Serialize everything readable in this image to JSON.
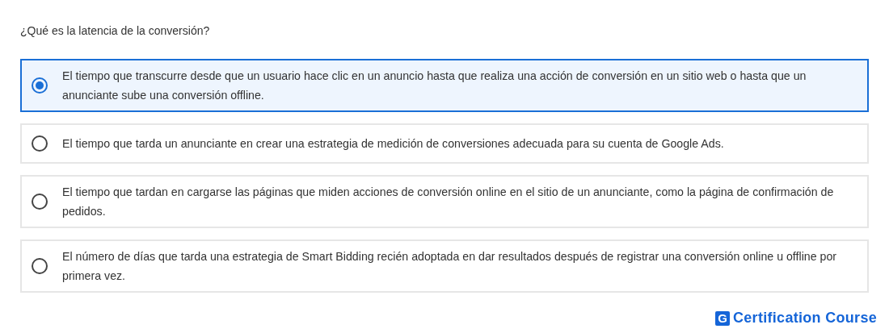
{
  "question": "¿Qué es la latencia de la conversión?",
  "options": [
    {
      "text": "El tiempo que transcurre desde que un usuario hace clic en un anuncio hasta que realiza una acción de conversión en un sitio web o hasta que un anunciante sube una conversión offline.",
      "selected": true
    },
    {
      "text": "El tiempo que tarda un anunciante en crear una estrategia de medición de conversiones adecuada para su cuenta de Google Ads.",
      "selected": false
    },
    {
      "text": "El tiempo que tardan en cargarse las páginas que miden acciones de conversión online en el sitio de un anunciante, como la página de confirmación de pedidos.",
      "selected": false
    },
    {
      "text": "El número de días que tarda una estrategia de Smart Bidding recién adoptada en dar resultados después de registrar una conversión online u offline por primera vez.",
      "selected": false
    }
  ],
  "brand": {
    "mark": "G",
    "name": "Certification Course"
  }
}
